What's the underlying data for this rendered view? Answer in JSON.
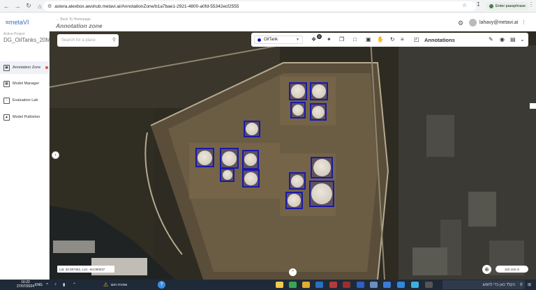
{
  "browser": {
    "url": "astera.alexbox.awshub.metavi.ai/AnnotationZone/b1a7bae1-2921-4800-a0fd-55342ecf2555",
    "passphrase_label": "Enter passphrase"
  },
  "header": {
    "logo_text": "metaVI",
    "back_link": "← Back To Homepage",
    "page_title": "Annotation zone",
    "user_email": "lahavy@metavi.ai"
  },
  "sidebar": {
    "active_project_label": "Active Project",
    "project_name": "DG_OilTanks_20M",
    "items": [
      {
        "label": "Annotation Zone",
        "icon": "annotation-icon",
        "active": true
      },
      {
        "label": "Model Manager",
        "icon": "model-icon",
        "active": false
      },
      {
        "label": "Evaluation Lab",
        "icon": "evaluation-icon",
        "active": false
      },
      {
        "label": "Model Publisher",
        "icon": "publisher-icon",
        "active": false
      }
    ]
  },
  "map": {
    "search_placeholder": "Search for a place",
    "coords": "Lat: 30.087362, Lon: -94.090037",
    "scale": "102.102 m"
  },
  "toolbar": {
    "class_label": "OilTank",
    "class_color": "#1a1aa8",
    "badge_count": "0",
    "annotations_title": "Annotations"
  },
  "taskbar": {
    "time": "16:22",
    "date": "27/07/2024",
    "lang": "ENG",
    "alert_text": "אזהרת חום",
    "search_placeholder": "הקלד כאן כדי לחפש"
  }
}
